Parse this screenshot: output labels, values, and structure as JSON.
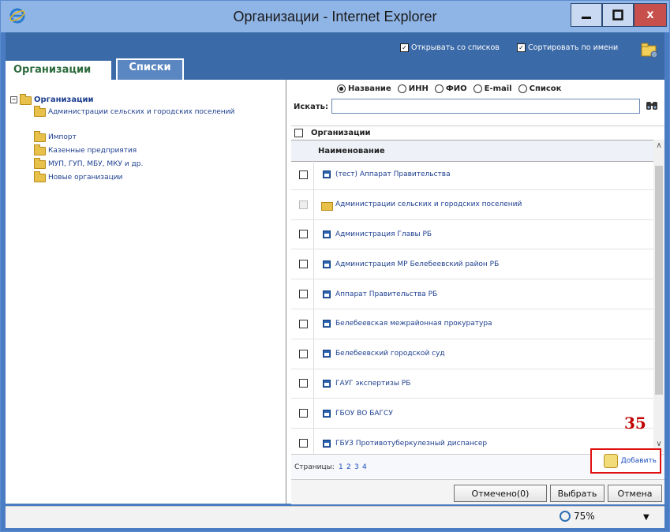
{
  "window": {
    "title": "Организации - Internet Explorer",
    "close_glyph": "x"
  },
  "tabs": [
    {
      "label": "Организации",
      "active": true
    },
    {
      "label": "Списки",
      "active": false
    }
  ],
  "options": {
    "open_from_lists": {
      "label": "Открывать со списков",
      "checked": true
    },
    "sort_by_name": {
      "label": "Сортировать по имени",
      "checked": true
    }
  },
  "tree": {
    "root": "Организации",
    "items": [
      "Администрации сельских и городских поселений",
      "Импорт",
      "Казенные предприятия",
      "МУП, ГУП, МБУ, МКУ и др.",
      "Новые организации"
    ]
  },
  "search": {
    "label": "Искать:",
    "value": "",
    "radios": [
      {
        "label": "Название",
        "selected": true
      },
      {
        "label": "ИНН",
        "selected": false
      },
      {
        "label": "ФИО",
        "selected": false
      },
      {
        "label": "E-mail",
        "selected": false
      },
      {
        "label": "Список",
        "selected": false
      }
    ]
  },
  "grid": {
    "group_header": "Организации",
    "column_header": "Наименование",
    "rows": [
      {
        "name": "(тест) Аппарат Правительства",
        "type": "org"
      },
      {
        "name": "Администрации сельских и городских поселений",
        "type": "folder"
      },
      {
        "name": "Администрация Главы РБ",
        "type": "org"
      },
      {
        "name": "Администрация МР Белебеевский район РБ",
        "type": "org"
      },
      {
        "name": "Аппарат Правительства РБ",
        "type": "org"
      },
      {
        "name": "Белебеевская межрайонная прокуратура",
        "type": "org"
      },
      {
        "name": "Белебеевский городской суд",
        "type": "org"
      },
      {
        "name": "ГАУГ экспертизы РБ",
        "type": "org"
      },
      {
        "name": "ГБОУ ВО БАГСУ",
        "type": "org"
      },
      {
        "name": "ГБУЗ Противотуберкулезный диспансер",
        "type": "org"
      }
    ]
  },
  "annotation": "35",
  "pager": {
    "label": "Страницы:",
    "pages": [
      "1",
      "2",
      "3",
      "4"
    ]
  },
  "add_button": "Добавить",
  "buttons": {
    "marked": "Отмечено(0)",
    "select": "Выбрать",
    "cancel": "Отмена"
  },
  "status": {
    "zoom": "75%"
  },
  "colors": {
    "title_bar": "#8fb4e6",
    "frame": "#3b6aa8",
    "close_button": "#c7504c",
    "link": "#1d3f8f",
    "highlight_border": "#e01010"
  }
}
